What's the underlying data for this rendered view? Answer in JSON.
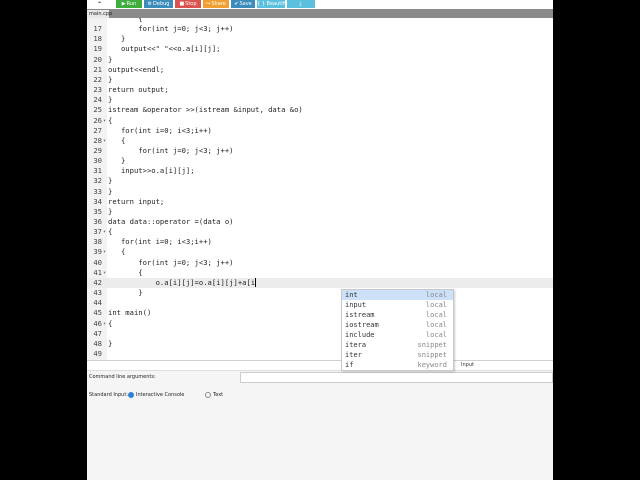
{
  "toolbar": {
    "buttons": [
      {
        "label": "",
        "icon": "❝",
        "color": "#ffffff",
        "text_color": "#333333"
      },
      {
        "label": "Run",
        "icon": "▶",
        "color": "#3fae3f"
      },
      {
        "label": "Debug",
        "icon": "⚙",
        "color": "#3c8dbc"
      },
      {
        "label": "Stop",
        "icon": "■",
        "color": "#d9534f"
      },
      {
        "label": "Share",
        "icon": "↪",
        "color": "#f0a030"
      },
      {
        "label": "Save",
        "icon": "✔",
        "color": "#3c8dbc"
      },
      {
        "label": "{ } Beautify",
        "icon": "",
        "color": "#5bc0de"
      },
      {
        "label": "",
        "icon": "⤓",
        "color": "#5bc0de"
      }
    ]
  },
  "file_tab": {
    "name": "main.cpp"
  },
  "editor": {
    "active_line": 42,
    "lines": [
      {
        "n": "",
        "fold": "",
        "code": "       {"
      },
      {
        "n": "17",
        "fold": "",
        "code": "       for(int j=0; j<3; j++)"
      },
      {
        "n": "18",
        "fold": "",
        "code": "   }"
      },
      {
        "n": "19",
        "fold": "",
        "code": "   output<<\" \"<<o.a[i][j];"
      },
      {
        "n": "20",
        "fold": "",
        "code": "}"
      },
      {
        "n": "21",
        "fold": "",
        "code": "output<<endl;"
      },
      {
        "n": "22",
        "fold": "",
        "code": "}"
      },
      {
        "n": "23",
        "fold": "",
        "code": "return output;"
      },
      {
        "n": "24",
        "fold": "",
        "code": "}"
      },
      {
        "n": "25",
        "fold": "",
        "code": "istream &operator >>(istream &input, data &o)"
      },
      {
        "n": "26",
        "fold": "▾",
        "code": "{"
      },
      {
        "n": "27",
        "fold": "",
        "code": "   for(int i=0; i<3;i++)"
      },
      {
        "n": "28",
        "fold": "▾",
        "code": "   {"
      },
      {
        "n": "29",
        "fold": "",
        "code": "       for(int j=0; j<3; j++)"
      },
      {
        "n": "30",
        "fold": "",
        "code": "   }"
      },
      {
        "n": "31",
        "fold": "",
        "code": "   input>>o.a[i][j];"
      },
      {
        "n": "32",
        "fold": "",
        "code": "}"
      },
      {
        "n": "33",
        "fold": "",
        "code": "}"
      },
      {
        "n": "34",
        "fold": "",
        "code": "return input;"
      },
      {
        "n": "35",
        "fold": "",
        "code": "}"
      },
      {
        "n": "36",
        "fold": "",
        "code": "data data::operator =(data o)"
      },
      {
        "n": "37",
        "fold": "▾",
        "code": "{"
      },
      {
        "n": "38",
        "fold": "",
        "code": "   for(int i=0; i<3;i++)"
      },
      {
        "n": "39",
        "fold": "▾",
        "code": "   {"
      },
      {
        "n": "40",
        "fold": "",
        "code": "       for(int j=0; j<3; j++)"
      },
      {
        "n": "41",
        "fold": "▾",
        "code": "       {"
      },
      {
        "n": "42",
        "fold": "",
        "code": "           o.a[i][j]=o.a[i][j]+a[i"
      },
      {
        "n": "43",
        "fold": "",
        "code": "       }"
      },
      {
        "n": "44",
        "fold": "",
        "code": ""
      },
      {
        "n": "45",
        "fold": "",
        "code": "int main()"
      },
      {
        "n": "46",
        "fold": "▾",
        "code": "{"
      },
      {
        "n": "47",
        "fold": "",
        "code": ""
      },
      {
        "n": "48",
        "fold": "",
        "code": "}"
      },
      {
        "n": "49",
        "fold": "",
        "code": ""
      }
    ]
  },
  "autocomplete": {
    "items": [
      {
        "word": "int",
        "kind": "local"
      },
      {
        "word": "input",
        "kind": "local"
      },
      {
        "word": "istream",
        "kind": "local"
      },
      {
        "word": "iostream",
        "kind": "local"
      },
      {
        "word": "include",
        "kind": "local"
      },
      {
        "word": "itera",
        "kind": "snippet"
      },
      {
        "word": "iter",
        "kind": "snippet"
      },
      {
        "word": "if",
        "kind": "keyword"
      }
    ],
    "selected_index": 0
  },
  "bottom": {
    "input_tab": "Input",
    "args_label": "Command line arguments:",
    "stdin_label": "Standard Input:",
    "option_console": "Interactive Console",
    "option_text": "Text"
  }
}
